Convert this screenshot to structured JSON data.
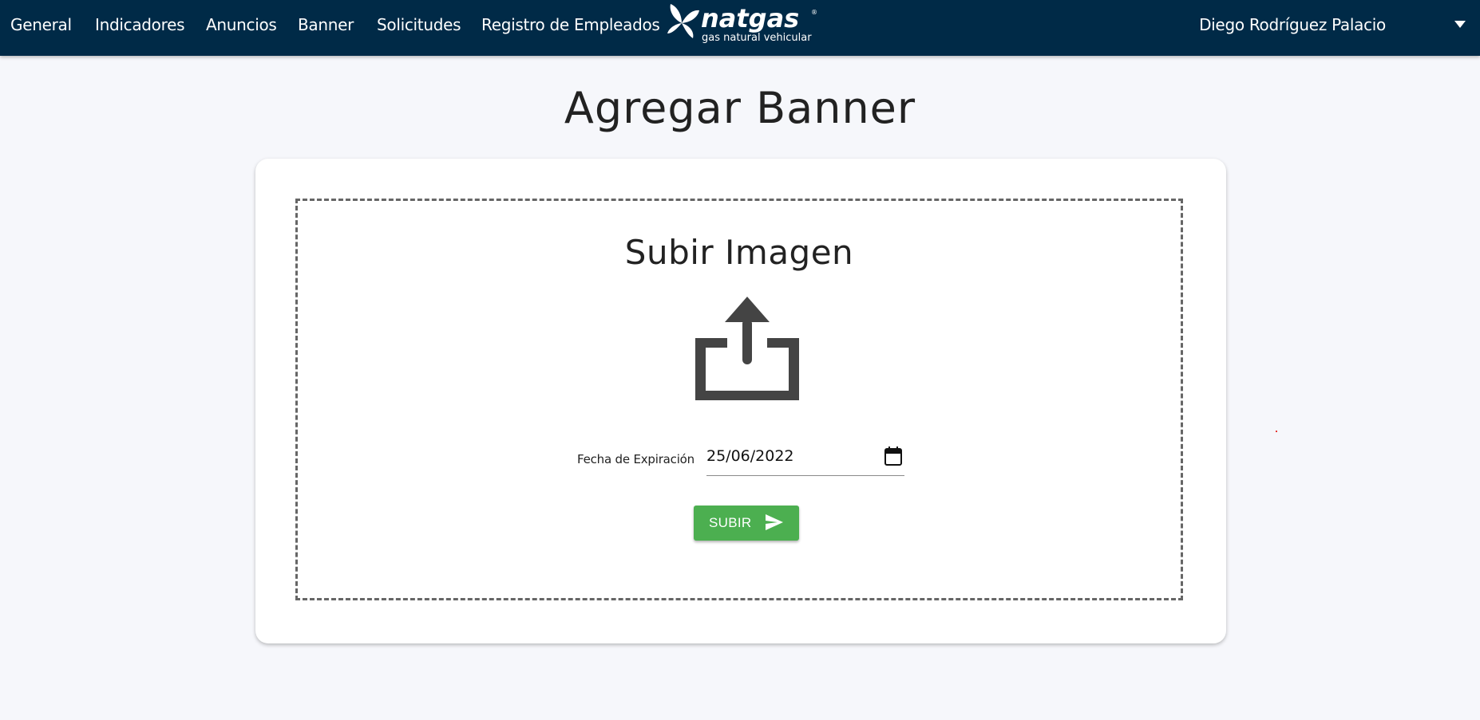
{
  "nav": {
    "links": [
      "General",
      "Indicadores",
      "Anuncios",
      "Banner",
      "Solicitudes",
      "Registro de Empleados"
    ],
    "logo": {
      "brand": "natgas",
      "tagline": "gas natural vehicular",
      "icon": "natgas-leaf-logo"
    },
    "user_name": "Diego Rodríguez Palacio",
    "user_menu_icon": "caret-down-icon"
  },
  "page": {
    "title": "Agregar Banner"
  },
  "upload": {
    "title": "Subir Imagen",
    "icon": "upload-icon",
    "date_label": "Fecha de Expiración",
    "date_value": "25/06/2022",
    "date_icon": "calendar-icon",
    "submit_label": "SUBIR",
    "submit_icon": "send-icon"
  },
  "colors": {
    "navbar": "#002a47",
    "background": "#f6f7fb",
    "submit": "#4caf50",
    "icon": "#444444"
  }
}
